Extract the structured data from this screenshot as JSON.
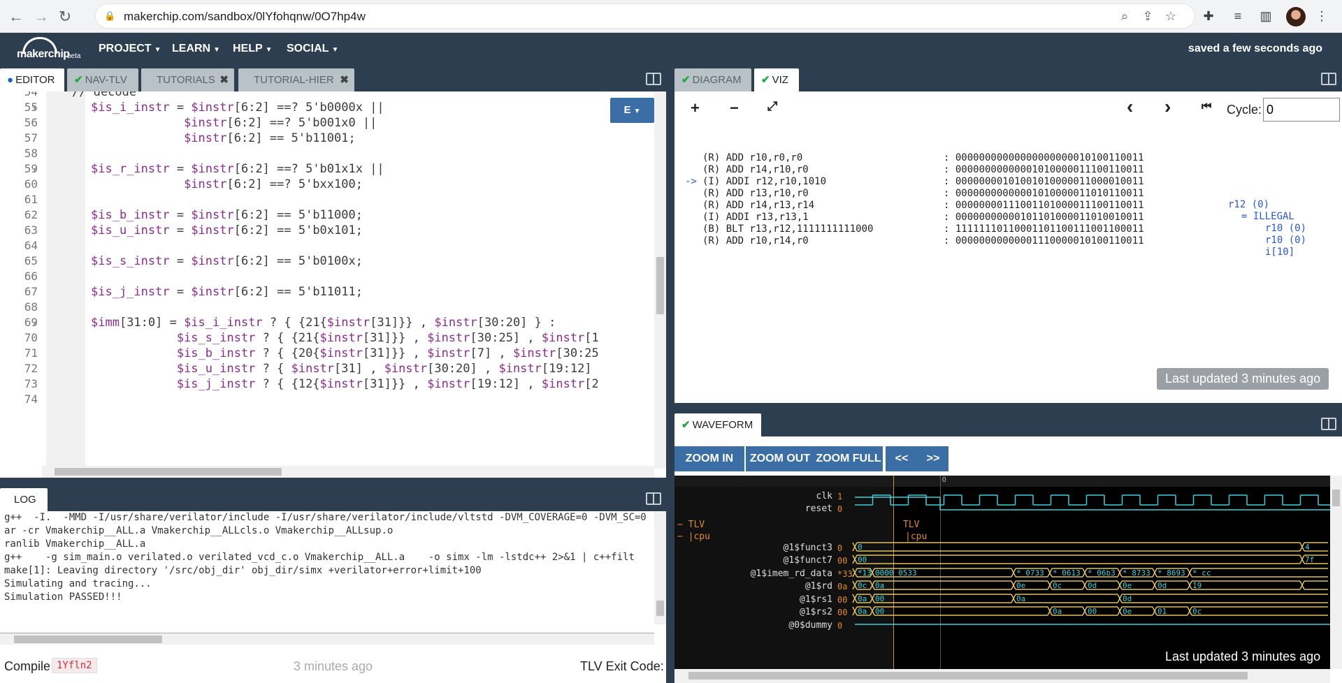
{
  "browser": {
    "url": "makerchip.com/sandbox/0lYfohqnw/0O7hp4w"
  },
  "app": {
    "logo_text": "makerchip",
    "beta": "beta",
    "menus": [
      "PROJECT",
      "LEARN",
      "HELP",
      "SOCIAL"
    ],
    "saved_status": "saved a few seconds ago"
  },
  "editor": {
    "tabs": [
      {
        "label": "EDITOR",
        "active": true,
        "status": "dot"
      },
      {
        "label": "NAV-TLV",
        "active": false,
        "status": "check"
      },
      {
        "label": "TUTORIALS",
        "active": false,
        "closable": true
      },
      {
        "label": "TUTORIAL-HIER",
        "active": false,
        "closable": true
      }
    ],
    "mode_button": "E",
    "line_numbers": [
      "54",
      "55",
      "56",
      "57",
      "58",
      "59",
      "60",
      "61",
      "62",
      "63",
      "64",
      "65",
      "66",
      "67",
      "68",
      "69",
      "70",
      "71",
      "72",
      "73",
      "74"
    ],
    "lines": [
      "// decode",
      "$is_i_instr = $instr[6:2] ==? 5'b0000x ||",
      "             $instr[6:2] ==? 5'b001x0 ||",
      "             $instr[6:2] == 5'b11001;",
      "",
      "$is_r_instr = $instr[6:2] ==? 5'b01x1x ||",
      "             $instr[6:2] ==? 5'bxx100;",
      "",
      "$is_b_instr = $instr[6:2] == 5'b11000;",
      "$is_u_instr = $instr[6:2] == 5'b0x101;",
      "",
      "$is_s_instr = $instr[6:2] == 5'b0100x;",
      "",
      "$is_j_instr = $instr[6:2] == 5'b11011;",
      "",
      "$imm[31:0] = $is_i_instr ? { {21{$instr[31]}} , $instr[30:20] } :",
      "            $is_s_instr ? { {21{$instr[31]}} , $instr[30:25] , $instr[1",
      "            $is_b_instr ? { {20{$instr[31]}} , $instr[7] , $instr[30:25",
      "            $is_u_instr ? { $instr[31] , $instr[30:20] , $instr[19:12]",
      "            $is_j_instr ? { {12{$instr[31]}} , $instr[19:12] , $instr[2",
      ""
    ]
  },
  "log": {
    "tab": "LOG",
    "lines": [
      "g++  -I.  -MMD -I/usr/share/verilator/include -I/usr/share/verilator/include/vltstd -DVM_COVERAGE=0 -DVM_SC=0",
      "ar -cr Vmakerchip__ALL.a Vmakerchip__ALLcls.o Vmakerchip__ALLsup.o",
      "ranlib Vmakerchip__ALL.a",
      "g++    -g sim_main.o verilated.o verilated_vcd_c.o Vmakerchip__ALL.a    -o simx -lm -lstdc++ 2>&1 | c++filt",
      "make[1]: Leaving directory '/src/obj_dir' obj_dir/simx +verilator+error+limit+100",
      "Simulating and tracing...",
      "Simulation PASSED!!!"
    ],
    "compile_label": "Compile",
    "compile_id": "1Yfln2",
    "compile_ago": "3 minutes ago",
    "exit_code_label": "TLV Exit Code:"
  },
  "viz": {
    "tabs": [
      {
        "label": "DIAGRAM",
        "active": false
      },
      {
        "label": "VIZ",
        "active": true
      }
    ],
    "zoom_in": "+",
    "zoom_out": "−",
    "fullscreen": "⤢",
    "prev": "‹",
    "next": "›",
    "first": "⏮",
    "cycle_label": "Cycle:",
    "cycle_value": "0",
    "current_marker": "->",
    "instructions": [
      {
        "asm": "(R) ADD r10,r0,r0",
        "bits": ": 00000000000000000000010100110011"
      },
      {
        "asm": "(R) ADD r14,r10,r0",
        "bits": ": 00000000000001010000011100110011"
      },
      {
        "asm": "(I) ADDI r12,r10,1010",
        "bits": ": 00000000101001010000011000010011"
      },
      {
        "asm": "(R) ADD r13,r10,r0",
        "bits": ": 00000000000001010000011010110011"
      },
      {
        "asm": "(R) ADD r14,r13,r14",
        "bits": ": 00000000111001101000011100110011"
      },
      {
        "asm": "(I) ADDI r13,r13,1",
        "bits": ": 00000000000101101000011010010011"
      },
      {
        "asm": "(B) BLT r13,r12,1111111111000",
        "bits": ": 11111110110001101100111001100011"
      },
      {
        "asm": "(R) ADD r10,r14,r0",
        "bits": ": 00000000000001110000010100110011"
      }
    ],
    "regfile": [
      "r12 (0)",
      "= ILLEGAL",
      "r10 (0)",
      "r10 (0)",
      "i[10]"
    ],
    "last_updated": "Last updated 3 minutes ago"
  },
  "waveform": {
    "tab": "WAVEFORM",
    "buttons": [
      "ZOOM IN",
      "ZOOM OUT",
      "ZOOM FULL",
      "<<",
      ">>"
    ],
    "time_zero": "0",
    "signals": [
      {
        "name": "clk",
        "val": "1"
      },
      {
        "name": "reset",
        "val": "0"
      },
      {
        "name": "@1$funct3",
        "val": "0"
      },
      {
        "name": "@1$funct7",
        "val": "00"
      },
      {
        "name": "@1$imem_rd_data",
        "val": "*33"
      },
      {
        "name": "@1$rd",
        "val": "0a"
      },
      {
        "name": "@1$rs1",
        "val": "00"
      },
      {
        "name": "@1$rs2",
        "val": "00"
      },
      {
        "name": "@0$dummy",
        "val": "0"
      }
    ],
    "scopes": [
      "TLV",
      "|cpu"
    ],
    "traces": {
      "funct3": [
        "0",
        "4"
      ],
      "funct7": [
        "00",
        "7f"
      ],
      "imem": [
        "*13",
        "0000_0533",
        "* 0733",
        "* 0613",
        "* 06b3",
        "* 8733",
        "* 8693",
        "* cc"
      ],
      "rd": [
        "0c",
        "0a",
        "0e",
        "0c",
        "0d",
        "0e",
        "0d",
        "19"
      ],
      "rs1": [
        "0a",
        "00",
        "0a",
        "0d"
      ],
      "rs2": [
        "0a",
        "00",
        "0a",
        "00",
        "0e",
        "01",
        "0c"
      ]
    },
    "last_updated": "Last updated 3 minutes ago"
  }
}
